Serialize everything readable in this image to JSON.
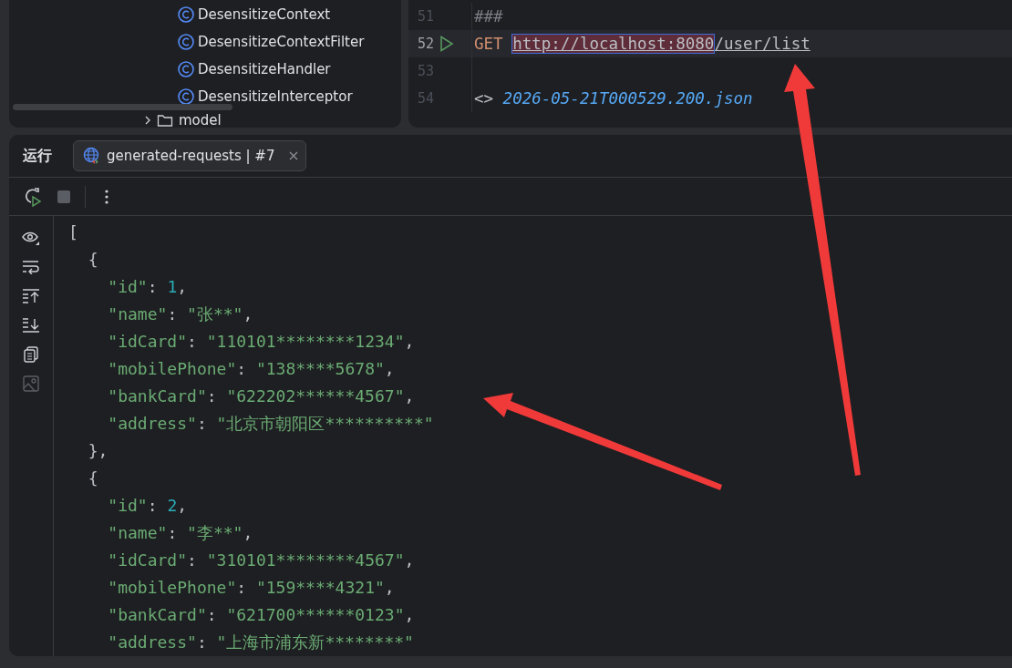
{
  "project_tree": {
    "items": [
      {
        "label": "DesensitizeContext",
        "kind": "class"
      },
      {
        "label": "DesensitizeContextFilter",
        "kind": "class"
      },
      {
        "label": "DesensitizeHandler",
        "kind": "class"
      },
      {
        "label": "DesensitizeInterceptor",
        "kind": "class"
      },
      {
        "label": "model",
        "kind": "folder",
        "expanded": false
      }
    ]
  },
  "editor": {
    "lines": [
      {
        "number": "51",
        "current": false,
        "runnable": false,
        "parts": [
          {
            "t": "###",
            "kind": "comment"
          }
        ]
      },
      {
        "number": "52",
        "current": true,
        "runnable": true,
        "parts": [
          {
            "t": "GET",
            "kind": "method"
          },
          {
            "t": "http://localhost:8080",
            "kind": "host"
          },
          {
            "t": "/user/list",
            "kind": "url"
          }
        ]
      },
      {
        "number": "53",
        "current": false,
        "runnable": false
      },
      {
        "number": "54",
        "current": false,
        "runnable": false,
        "parts": [
          {
            "t": "<>",
            "kind": "plain"
          },
          {
            "t": "2026-05-21T000529.200.json",
            "kind": "file"
          }
        ]
      }
    ]
  },
  "run_panel": {
    "title": "运行",
    "tabs": [
      {
        "label": "generated-requests | #7",
        "selected": true
      }
    ],
    "toolbar": [
      {
        "kind": "rerun",
        "disabled": false
      },
      {
        "kind": "stop",
        "disabled": true
      },
      {
        "kind": "more",
        "disabled": false
      }
    ],
    "side_tools": [
      {
        "kind": "view",
        "disabled": false
      },
      {
        "kind": "wrap",
        "disabled": false
      },
      {
        "kind": "top",
        "disabled": false
      },
      {
        "kind": "bottom",
        "disabled": false
      },
      {
        "kind": "copy",
        "disabled": false
      },
      {
        "kind": "image",
        "disabled": true
      }
    ],
    "response": {
      "open": "[",
      "objects": [
        {
          "open": "{",
          "close": "},",
          "fields": [
            {
              "key": "\"id\"",
              "colon": ":",
              "value": "1",
              "kind": "number",
              "end": ","
            },
            {
              "key": "\"name\"",
              "colon": ":",
              "value": "\"张**\"",
              "kind": "string",
              "end": ","
            },
            {
              "key": "\"idCard\"",
              "colon": ":",
              "value": "\"110101********1234\"",
              "kind": "string",
              "end": ","
            },
            {
              "key": "\"mobilePhone\"",
              "colon": ":",
              "value": "\"138****5678\"",
              "kind": "string",
              "end": ","
            },
            {
              "key": "\"bankCard\"",
              "colon": ":",
              "value": "\"622202******4567\"",
              "kind": "string",
              "end": ","
            },
            {
              "key": "\"address\"",
              "colon": ":",
              "value": "\"北京市朝阳区**********\"",
              "kind": "string"
            }
          ]
        },
        {
          "open": "{",
          "fields": [
            {
              "key": "\"id\"",
              "colon": ":",
              "value": "2",
              "kind": "number",
              "end": ","
            },
            {
              "key": "\"name\"",
              "colon": ":",
              "value": "\"李**\"",
              "kind": "string",
              "end": ","
            },
            {
              "key": "\"idCard\"",
              "colon": ":",
              "value": "\"310101********4567\"",
              "kind": "string",
              "end": ","
            },
            {
              "key": "\"mobilePhone\"",
              "colon": ":",
              "value": "\"159****4321\"",
              "kind": "string",
              "end": ","
            },
            {
              "key": "\"bankCard\"",
              "colon": ":",
              "value": "\"621700******0123\"",
              "kind": "string",
              "end": ","
            },
            {
              "key": "\"address\"",
              "colon": ":",
              "value": "\"上海市浦东新********\"",
              "kind": "string"
            }
          ]
        }
      ]
    }
  }
}
